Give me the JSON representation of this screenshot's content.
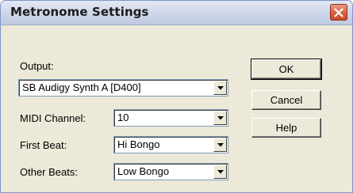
{
  "window": {
    "title": "Metronome Settings",
    "close_icon": "close-icon"
  },
  "output": {
    "label": "Output:",
    "value": "SB Audigy Synth A [D400]"
  },
  "midi_channel": {
    "label": "MIDI Channel:",
    "value": "10"
  },
  "first_beat": {
    "label": "First Beat:",
    "value": "Hi Bongo"
  },
  "other_beats": {
    "label": "Other Beats:",
    "value": "Low Bongo"
  },
  "buttons": {
    "ok": "OK",
    "cancel": "Cancel",
    "help": "Help"
  },
  "colors": {
    "dialog_bg": "#ece9d8",
    "close_button": "#d8603d",
    "field_border": "#7f9db9"
  }
}
